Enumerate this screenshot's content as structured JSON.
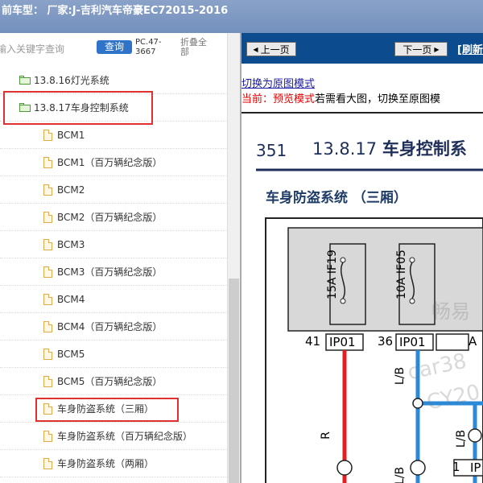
{
  "window": {
    "title": "前车型：  厂家:J-吉利汽车帝豪EC72015-2016"
  },
  "search": {
    "placeholder": "输入关键字查询",
    "button": "查询",
    "pc_label": "PC.47-3667",
    "collapse_label": "折叠全部"
  },
  "tree": {
    "folders": [
      {
        "label": "13.8.16灯光系统"
      },
      {
        "label": "13.8.17车身控制系统"
      }
    ],
    "files": [
      {
        "label": "BCM1"
      },
      {
        "label": "BCM1（百万辆纪念版）"
      },
      {
        "label": "BCM2"
      },
      {
        "label": "BCM2（百万辆纪念版）"
      },
      {
        "label": "BCM3"
      },
      {
        "label": "BCM3（百万辆纪念版）"
      },
      {
        "label": "BCM4"
      },
      {
        "label": "BCM4（百万辆纪念版）"
      },
      {
        "label": "BCM5"
      },
      {
        "label": "BCM5（百万辆纪念版）"
      },
      {
        "label": "车身防盗系统（三厢）"
      },
      {
        "label": "车身防盗系统（百万辆纪念版）"
      },
      {
        "label": "车身防盗系统（两厢）"
      }
    ]
  },
  "viewer": {
    "prev_label": "上一页",
    "next_label": "下一页",
    "refresh_label": "[刷新",
    "switch_link": "切换为原图模式",
    "status_prefix": "当前：预览模式",
    "status_suffix": "若需看大图，切换至原图模",
    "diagram": {
      "page_num": "351",
      "section": "13.8.17",
      "section_title": "车身控制系",
      "subtitle": "车身防盗系统 （三厢）",
      "fuse1_label": "IF19",
      "fuse1_rating": "15A",
      "fuse2_label": "IF05",
      "fuse2_rating": "10A",
      "pin1": "41",
      "conn1": "IP01",
      "pin2": "36",
      "conn2": "IP01",
      "conn3_partial": "A",
      "wire_r": "R",
      "wire_lb1": "L/B",
      "wire_lb2": "L/B",
      "wire_lb3": "L/B",
      "bottom_pin": "1",
      "bottom_conn": "IP",
      "watermark1": "畅易",
      "watermark2": "car38",
      "watermark3": "CY20"
    }
  },
  "colors": {
    "nav_bg": "#0b4b8e",
    "highlight": "#e03131",
    "search_btn": "#2f74c9"
  }
}
